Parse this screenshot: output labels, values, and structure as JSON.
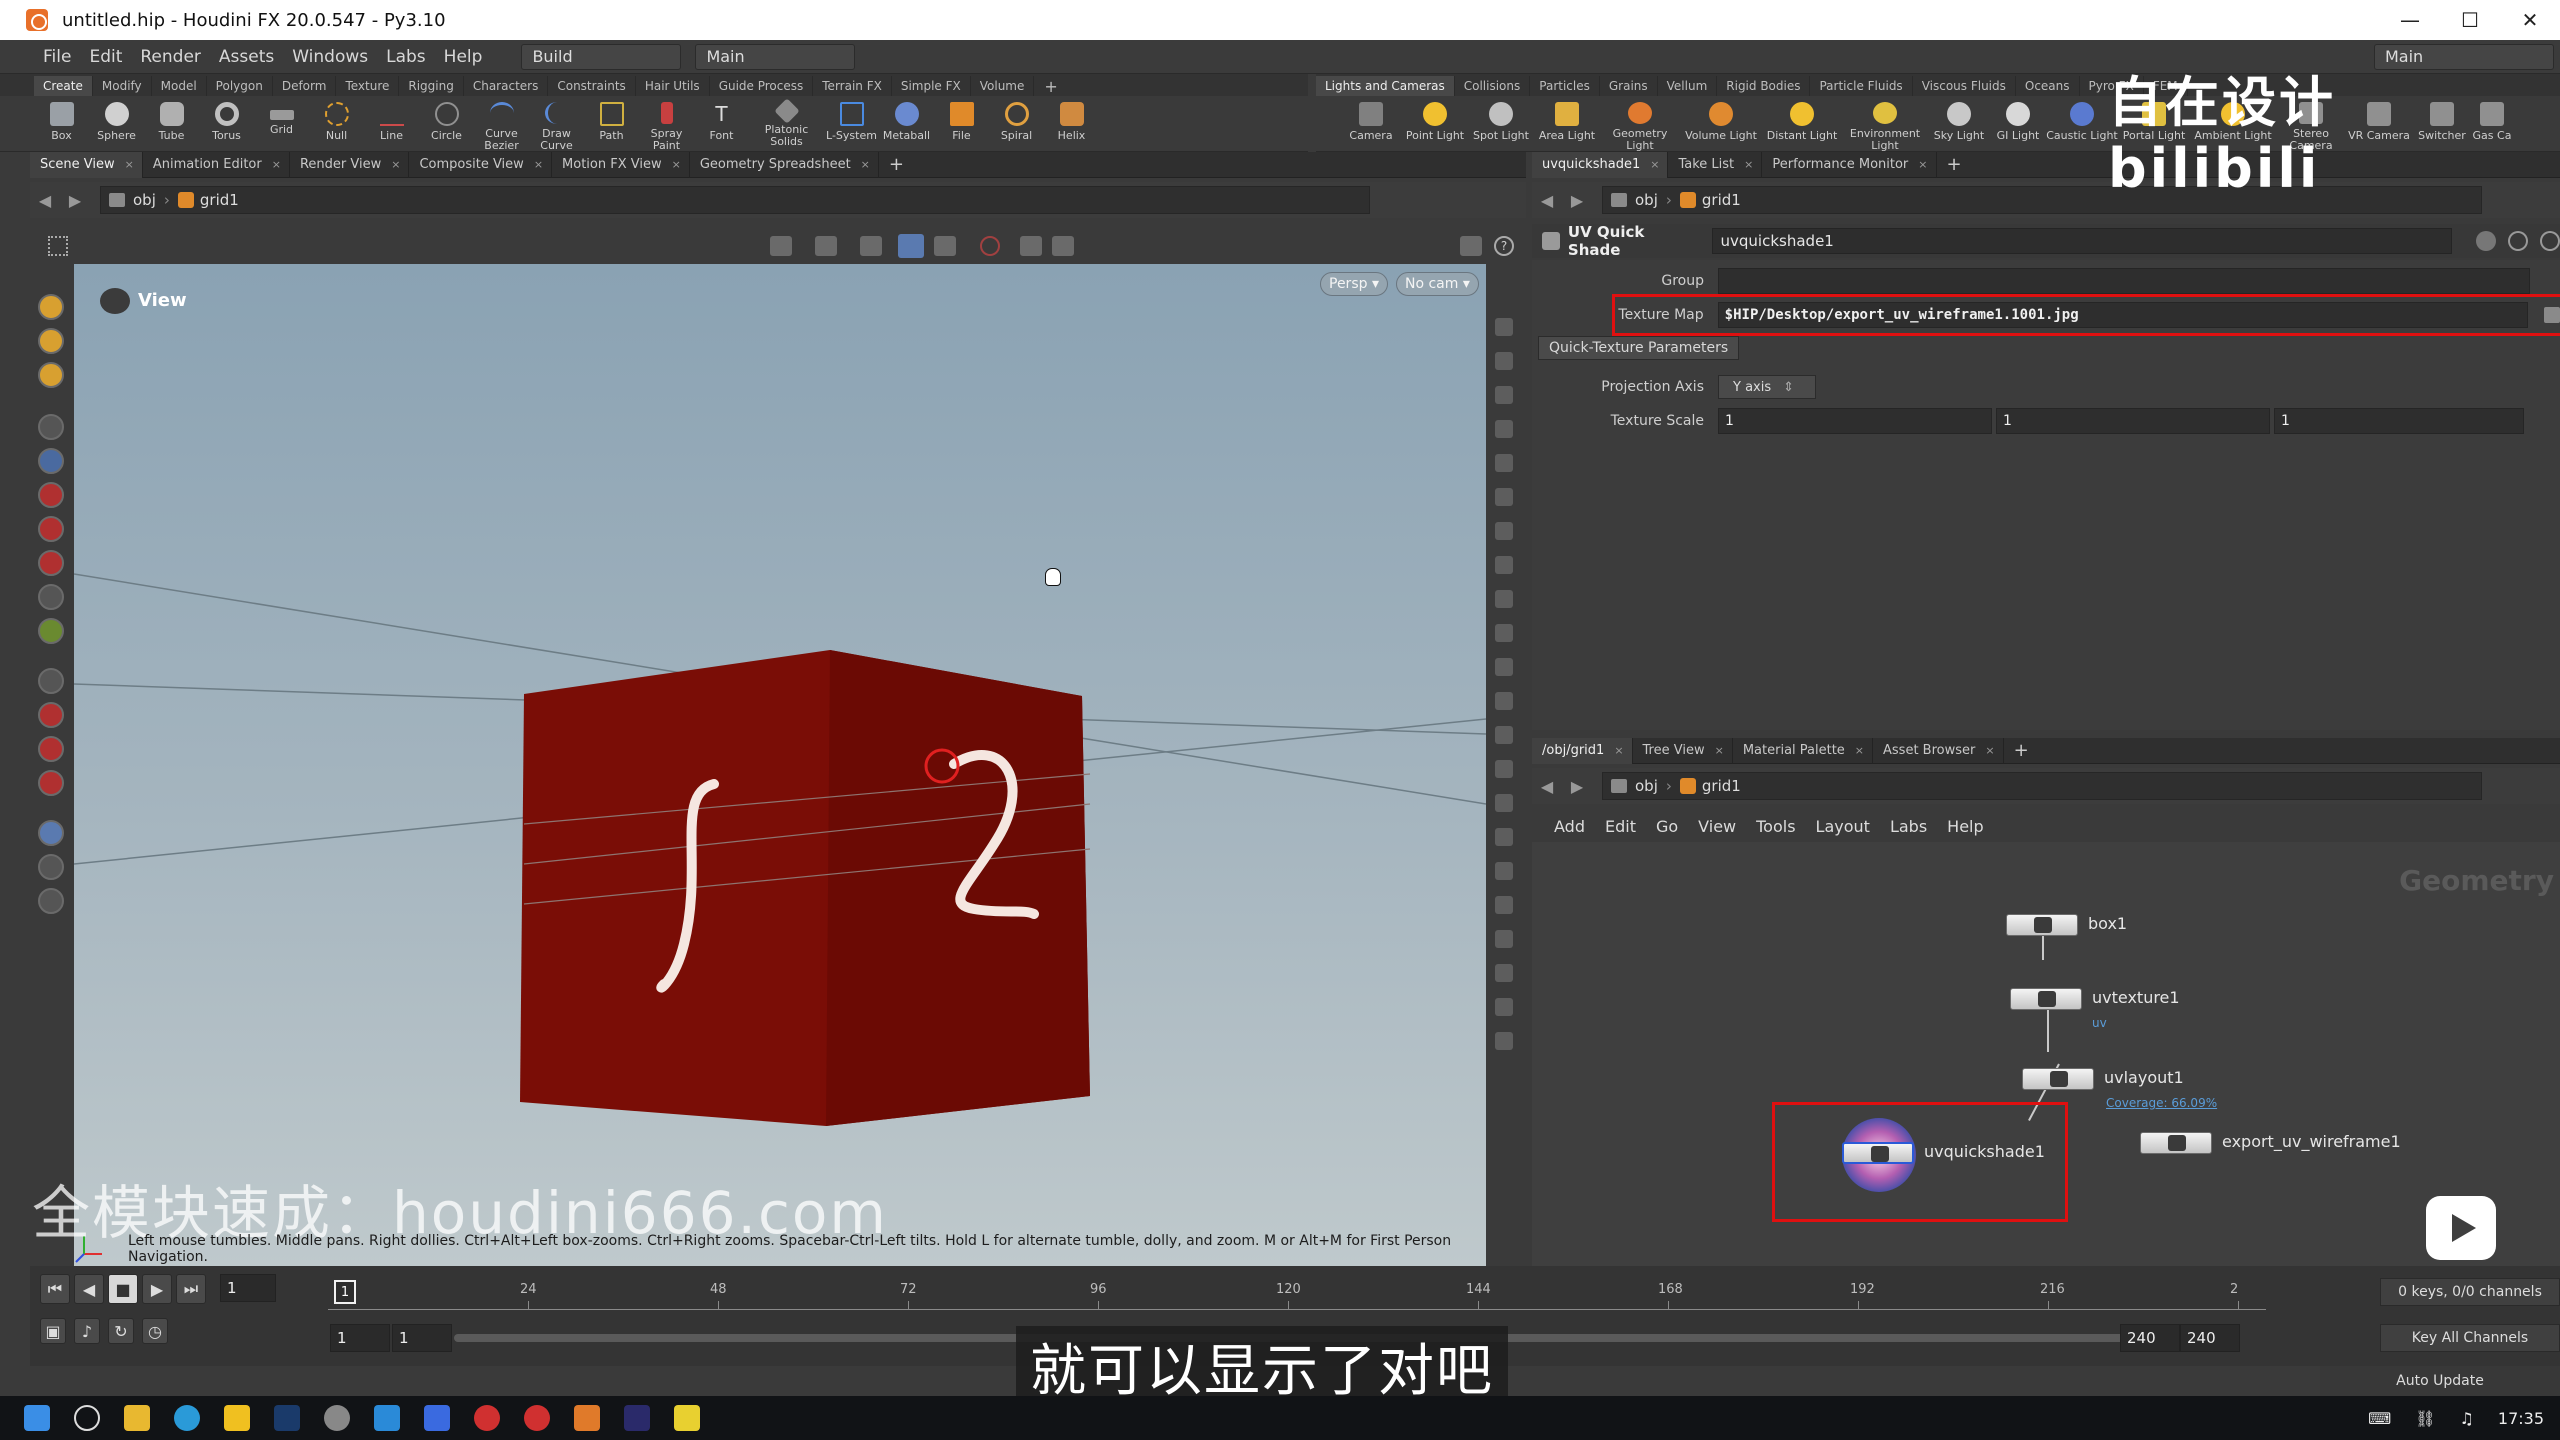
{
  "window": {
    "title": "untitled.hip - Houdini FX 20.0.547 - Py3.10",
    "controls": [
      "—",
      "☐",
      "✕"
    ]
  },
  "menu": {
    "items": [
      "File",
      "Edit",
      "Render",
      "Assets",
      "Windows",
      "Labs",
      "Help"
    ],
    "desktop_build": "Build",
    "desktop_main": "Main",
    "desktop_right": "Main"
  },
  "shelf_left": {
    "tabs": [
      "Create",
      "Modify",
      "Model",
      "Polygon",
      "Deform",
      "Texture",
      "Rigging",
      "Characters",
      "Constraints",
      "Hair Utils",
      "Guide Process",
      "Terrain FX",
      "Simple FX",
      "Volume"
    ],
    "tools": [
      "Box",
      "Sphere",
      "Tube",
      "Torus",
      "Grid",
      "Null",
      "Line",
      "Circle",
      "Curve Bezier",
      "Draw Curve",
      "Path",
      "Spray Paint",
      "Font",
      "Platonic Solids",
      "L-System",
      "Metaball",
      "File",
      "Spiral",
      "Helix"
    ]
  },
  "shelf_right": {
    "tabs": [
      "Lights and Cameras",
      "Collisions",
      "Particles",
      "Grains",
      "Vellum",
      "Rigid Bodies",
      "Particle Fluids",
      "Viscous Fluids",
      "Oceans",
      "Pyro FX",
      "FEM"
    ],
    "tools": [
      "Camera",
      "Point Light",
      "Spot Light",
      "Area Light",
      "Geometry Light",
      "Volume Light",
      "Distant Light",
      "Environment Light",
      "Sky Light",
      "GI Light",
      "Caustic Light",
      "Portal Light",
      "Ambient Light",
      "Stereo Camera",
      "VR Camera",
      "Switcher",
      "Gas Ca"
    ]
  },
  "left_pane": {
    "tabs": [
      "Scene View",
      "Animation Editor",
      "Render View",
      "Composite View",
      "Motion FX View",
      "Geometry Spreadsheet"
    ],
    "path_obj": "obj",
    "path_node": "grid1"
  },
  "viewport": {
    "label": "View",
    "persp": "Persp ▾",
    "cam": "No cam ▾",
    "status": "Left mouse tumbles. Middle pans. Right dollies. Ctrl+Alt+Left box-zooms. Ctrl+Right zooms. Spacebar-Ctrl-Left tilts. Hold L for alternate tumble, dolly, and zoom. M or Alt+M for First Person Navigation.",
    "cube_color": "#7a0d06",
    "watermark": "全模块速成：houdini666.com"
  },
  "param_pane": {
    "tabs": [
      "uvquickshade1",
      "Take List",
      "Performance Monitor"
    ],
    "path_obj": "obj",
    "path_node": "grid1",
    "op_type": "UV Quick Shade",
    "node_name": "uvquickshade1",
    "group_label": "Group",
    "group_value": "",
    "texture_map_label": "Texture Map",
    "texture_map_value": "$HIP/Desktop/export_uv_wireframe1.1001.jpg",
    "folder_tab": "Quick-Texture Parameters",
    "projection_axis_label": "Projection Axis",
    "projection_axis_value": "Y axis",
    "texture_scale_label": "Texture Scale",
    "texture_scale": [
      "1",
      "1",
      "1"
    ]
  },
  "network_pane": {
    "tabs": [
      "/obj/grid1",
      "Tree View",
      "Material Palette",
      "Asset Browser"
    ],
    "path_obj": "obj",
    "path_node": "grid1",
    "menu": [
      "Add",
      "Edit",
      "Go",
      "View",
      "Tools",
      "Layout",
      "Labs",
      "Help"
    ],
    "context_label": "Geometry",
    "nodes": {
      "box": "box1",
      "uvtexture": "uvtexture1",
      "uvtexture_sub": "uv",
      "uvlayout": "uvlayout1",
      "uvlayout_sub": "Coverage: 66.09%",
      "uvquickshade": "uvquickshade1",
      "export": "export_uv_wireframe1"
    }
  },
  "timeline": {
    "current_frame": "1",
    "playhead": "1",
    "ticks": [
      "24",
      "48",
      "72",
      "96",
      "120",
      "144",
      "168",
      "192",
      "216",
      "2"
    ],
    "start1": "1",
    "start2": "1",
    "end1": "240",
    "end2": "240",
    "keys_info": "0 keys, 0/0 channels",
    "key_all": "Key All Channels",
    "auto_update": "Auto Update"
  },
  "subtitle": "就可以显示了对吧",
  "overlay": {
    "design_text": "自在设计",
    "bili_logo": "bilibili"
  },
  "taskbar": {
    "time": "17:35"
  },
  "colors": {
    "highlight_red": "#e01010",
    "accent_orange": "#e08a2a",
    "coverage_blue": "#5a9cd8"
  }
}
